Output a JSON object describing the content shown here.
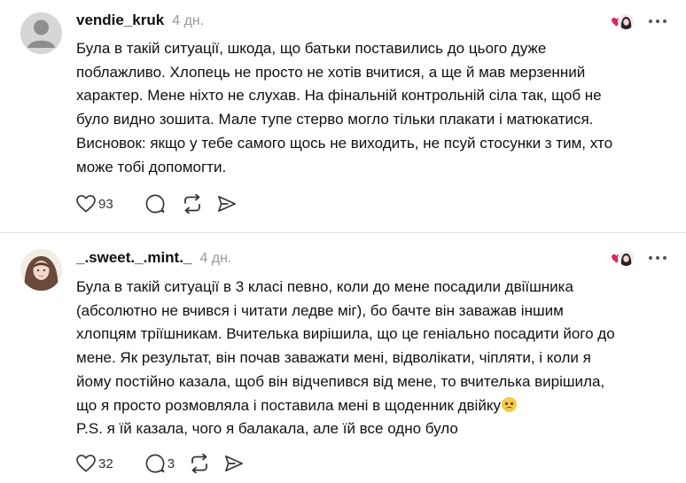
{
  "colors": {
    "heart_red": "#e0245e",
    "text": "#101010",
    "muted": "#9a9a9a",
    "icon": "#333333",
    "divider": "#e1e1e1"
  },
  "comments": [
    {
      "username": "vendie_kruk",
      "time": "4 дн.",
      "avatar": "default-avatar-icon",
      "lines": [
        "Була в такій ситуації, шкода, що батьки поставились до цього дуже",
        "поблажливо. Хлопець не просто не хотів вчитися, а ще й мав мерзенний",
        "характер. Мене ніхто не слухав. На фінальній контрольній сіла так, щоб не",
        "було видно зошита. Мале тупе стерво могло тільки плакати і матюкатися.",
        "Висновок: якщо у тебе самого щось не виходить, не псуй стосунки з тим, хто",
        "може тобі допомогти."
      ],
      "likes": "93",
      "replies": ""
    },
    {
      "username": "_.sweet._.mint._",
      "time": "4 дн.",
      "avatar": "profile-photo-avatar",
      "lines": [
        "Була в такій ситуації в 3 класі певно, коли до мене посадили двіїшника",
        "(абсолютно не вчився і читати ледве міг), бо бачте він заважав іншим",
        "хлопцям тріїшникам. Вчителька вирішила, що це геніально посадити його до",
        "мене. Як результат, він почав заважати мені, відволікати, чіпляти, і коли я",
        "йому постійно казала, щоб він відчепився від мене, то вчителька вирішила,",
        "що я просто розмовляла і поставила мені в щоденник двійку",
        "P.S. я їй казала, чого я балакала, але їй все одно було"
      ],
      "emoji": "sad-face-emoji",
      "likes": "32",
      "replies": "3"
    }
  ]
}
